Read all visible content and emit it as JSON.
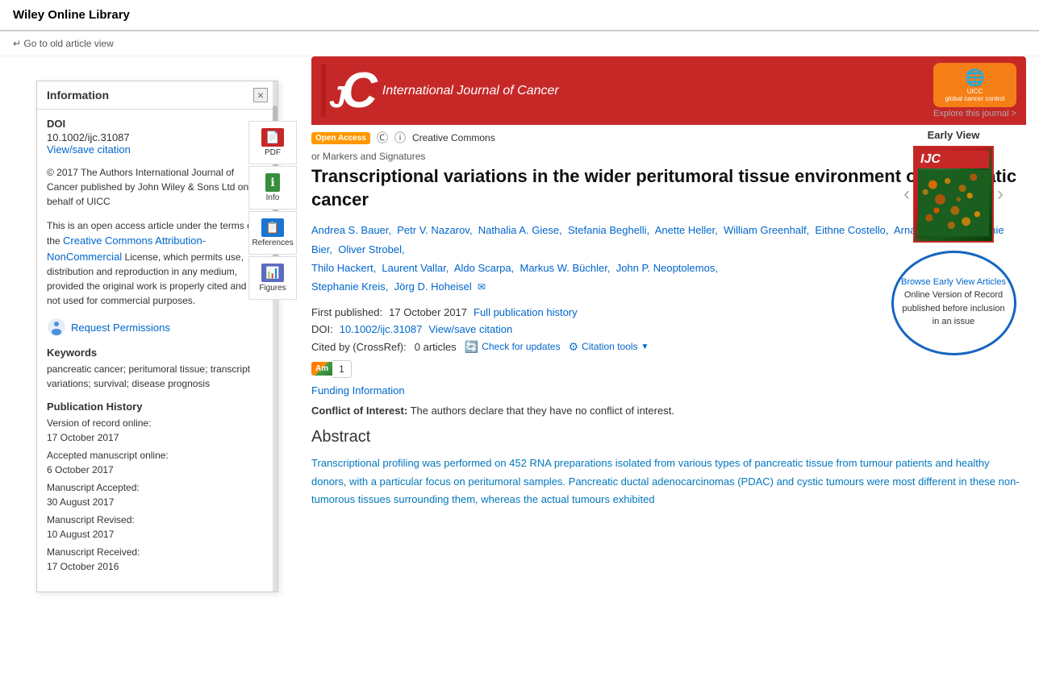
{
  "header": {
    "site_title": "Wiley Online Library"
  },
  "old_article_view": {
    "link_text": "↵ Go to old article view"
  },
  "sidebar": {
    "title": "Information",
    "close_label": "×",
    "doi_label": "DOI",
    "doi_value": "10.1002/ijc.31087",
    "view_save_citation": "View/save citation",
    "copyright_text": "© 2017 The Authors International Journal of Cancer published by John Wiley & Sons Ltd on behalf of UICC",
    "license_text": "This is an open access article under the terms of the Creative Commons Attribution-NonCommercial License, which permits use, distribution and reproduction in any medium, provided the original work is properly cited and is not used for commercial purposes.",
    "cc_link": "Creative Commons Attribution-NonCommercial",
    "request_permissions": "Request Permissions",
    "keywords_label": "Keywords",
    "keywords_value": "pancreatic cancer; peritumoral tissue; transcript variations; survival; disease prognosis",
    "pub_history_label": "Publication History",
    "pub_history_items": [
      {
        "label": "Version of record online:",
        "date": "17 October 2017"
      },
      {
        "label": "Accepted manuscript online:",
        "date": "6 October 2017"
      },
      {
        "label": "Manuscript Accepted:",
        "date": "30 August 2017"
      },
      {
        "label": "Manuscript Revised:",
        "date": "10 August 2017"
      },
      {
        "label": "Manuscript Received:",
        "date": "17 October 2016"
      }
    ]
  },
  "vertical_nav": [
    {
      "id": "pdf",
      "label": "PDF",
      "icon": "📄",
      "color": "pdf"
    },
    {
      "id": "info",
      "label": "Info",
      "icon": "ℹ",
      "color": "info"
    },
    {
      "id": "references",
      "label": "References",
      "icon": "📑",
      "color": "refs"
    },
    {
      "id": "figures",
      "label": "Figures",
      "icon": "📊",
      "color": "figs"
    }
  ],
  "journal": {
    "name": "International Journal of Cancer",
    "letters": "JC",
    "explore_link": "Explore this journal >",
    "uicc_text": "UICC",
    "uicc_subtext": "global cancer control"
  },
  "article": {
    "access_type": "Open Access",
    "cc_label": "Creative Commons",
    "section_header": "or Markers and Signatures",
    "title": "Transcriptional variations in the wider peritumoral tissue environment of pancreatic cancer",
    "authors": [
      "Andrea S. Bauer",
      "Petr V. Nazarov",
      "Nathalia A. Giese",
      "Stefania Beghelli",
      "Anette Heller",
      "William Greenhalf",
      "Eithne Costello",
      "Arnaud Muller",
      "Melanie Bier",
      "Oliver Strobel",
      "Thilo Hackert",
      "Laurent Vallar",
      "Aldo Scarpa",
      "Markus W. Büchler",
      "John P. Neoptolemos",
      "Stephanie Kreis",
      "Jörg D. Hoheisel"
    ],
    "first_published_label": "First published:",
    "first_published_date": "17 October 2017",
    "full_pub_history": "Full publication history",
    "doi_label": "DOI:",
    "doi_value": "10.1002/ijc.31087",
    "view_save_citation": "View/save citation",
    "cited_by_label": "Cited by (CrossRef):",
    "cited_by_count": "0 articles",
    "check_for_updates": "Check for updates",
    "citation_tools": "Citation tools",
    "altmetric_score": "1",
    "funding_information": "Funding Information",
    "conflict_label": "Conflict of Interest:",
    "conflict_text": "The authors declare that they have no conflict of interest.",
    "abstract_title": "Abstract",
    "abstract_text": "Transcriptional profiling was performed on 452 RNA preparations isolated from various types of pancreatic tissue from tumour patients and healthy donors, with a particular focus on peritumoral samples. Pancreatic ductal adenocarcinomas (PDAC) and cystic tumours were most different in these non-tumorous tissues surrounding them, whereas the actual tumours exhibited"
  },
  "early_view": {
    "title": "Early View",
    "browse_link": "Browse Early View Articles",
    "circle_text": "Online Version of Record published before inclusion in an issue"
  }
}
